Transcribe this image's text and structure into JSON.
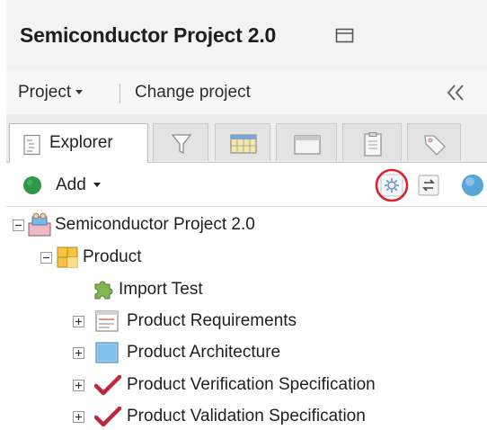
{
  "header": {
    "title": "Semiconductor Project 2.0"
  },
  "project_bar": {
    "project_menu": "Project",
    "change_project": "Change project"
  },
  "tabs": [
    {
      "label": "Explorer",
      "icon": "explorer-icon",
      "active": true
    },
    {
      "label": "",
      "icon": "filter-icon"
    },
    {
      "label": "",
      "icon": "table-view-icon"
    },
    {
      "label": "",
      "icon": "window-icon"
    },
    {
      "label": "",
      "icon": "document-icon"
    },
    {
      "label": "",
      "icon": "tag-icon"
    }
  ],
  "toolbar": {
    "add_label": "Add",
    "tools": [
      "settings-icon",
      "sync-icon",
      "info-icon"
    ],
    "highlight_color": "#d9232d"
  },
  "tree": [
    {
      "label": "Semiconductor Project 2.0",
      "level": 0,
      "icon": "project-icon",
      "expander": "minus"
    },
    {
      "label": "Product",
      "level": 1,
      "icon": "product-folder-icon",
      "expander": "minus"
    },
    {
      "label": "Import Test",
      "level": 2,
      "icon": "puzzle-icon",
      "expander": "none"
    },
    {
      "label": "Product Requirements",
      "level": 2,
      "icon": "requirements-icon",
      "expander": "plus"
    },
    {
      "label": "Product Architecture",
      "level": 2,
      "icon": "architecture-icon",
      "expander": "plus"
    },
    {
      "label": "Product Verification Specification",
      "level": 2,
      "icon": "checkmark-icon",
      "expander": "plus"
    },
    {
      "label": "Product Validation Specification",
      "level": 2,
      "icon": "checkmark-icon",
      "expander": "plus"
    }
  ]
}
